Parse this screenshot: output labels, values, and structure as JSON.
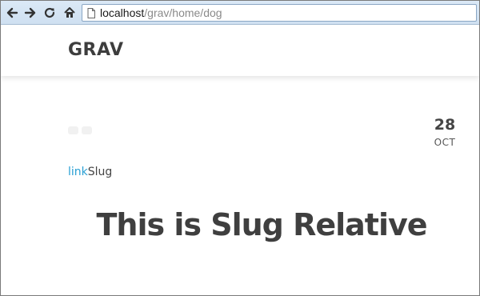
{
  "browser": {
    "url_host": "localhost",
    "url_path": "/grav/home/dog",
    "icons": [
      "back-arrow-icon",
      "forward-arrow-icon",
      "reload-icon",
      "home-icon",
      "page-icon"
    ]
  },
  "site": {
    "logo": "GRAV"
  },
  "post": {
    "date_day": "28",
    "date_month": "OCT",
    "link_text": "link",
    "link_suffix": "Slug",
    "heading": "This is Slug Relative"
  }
}
